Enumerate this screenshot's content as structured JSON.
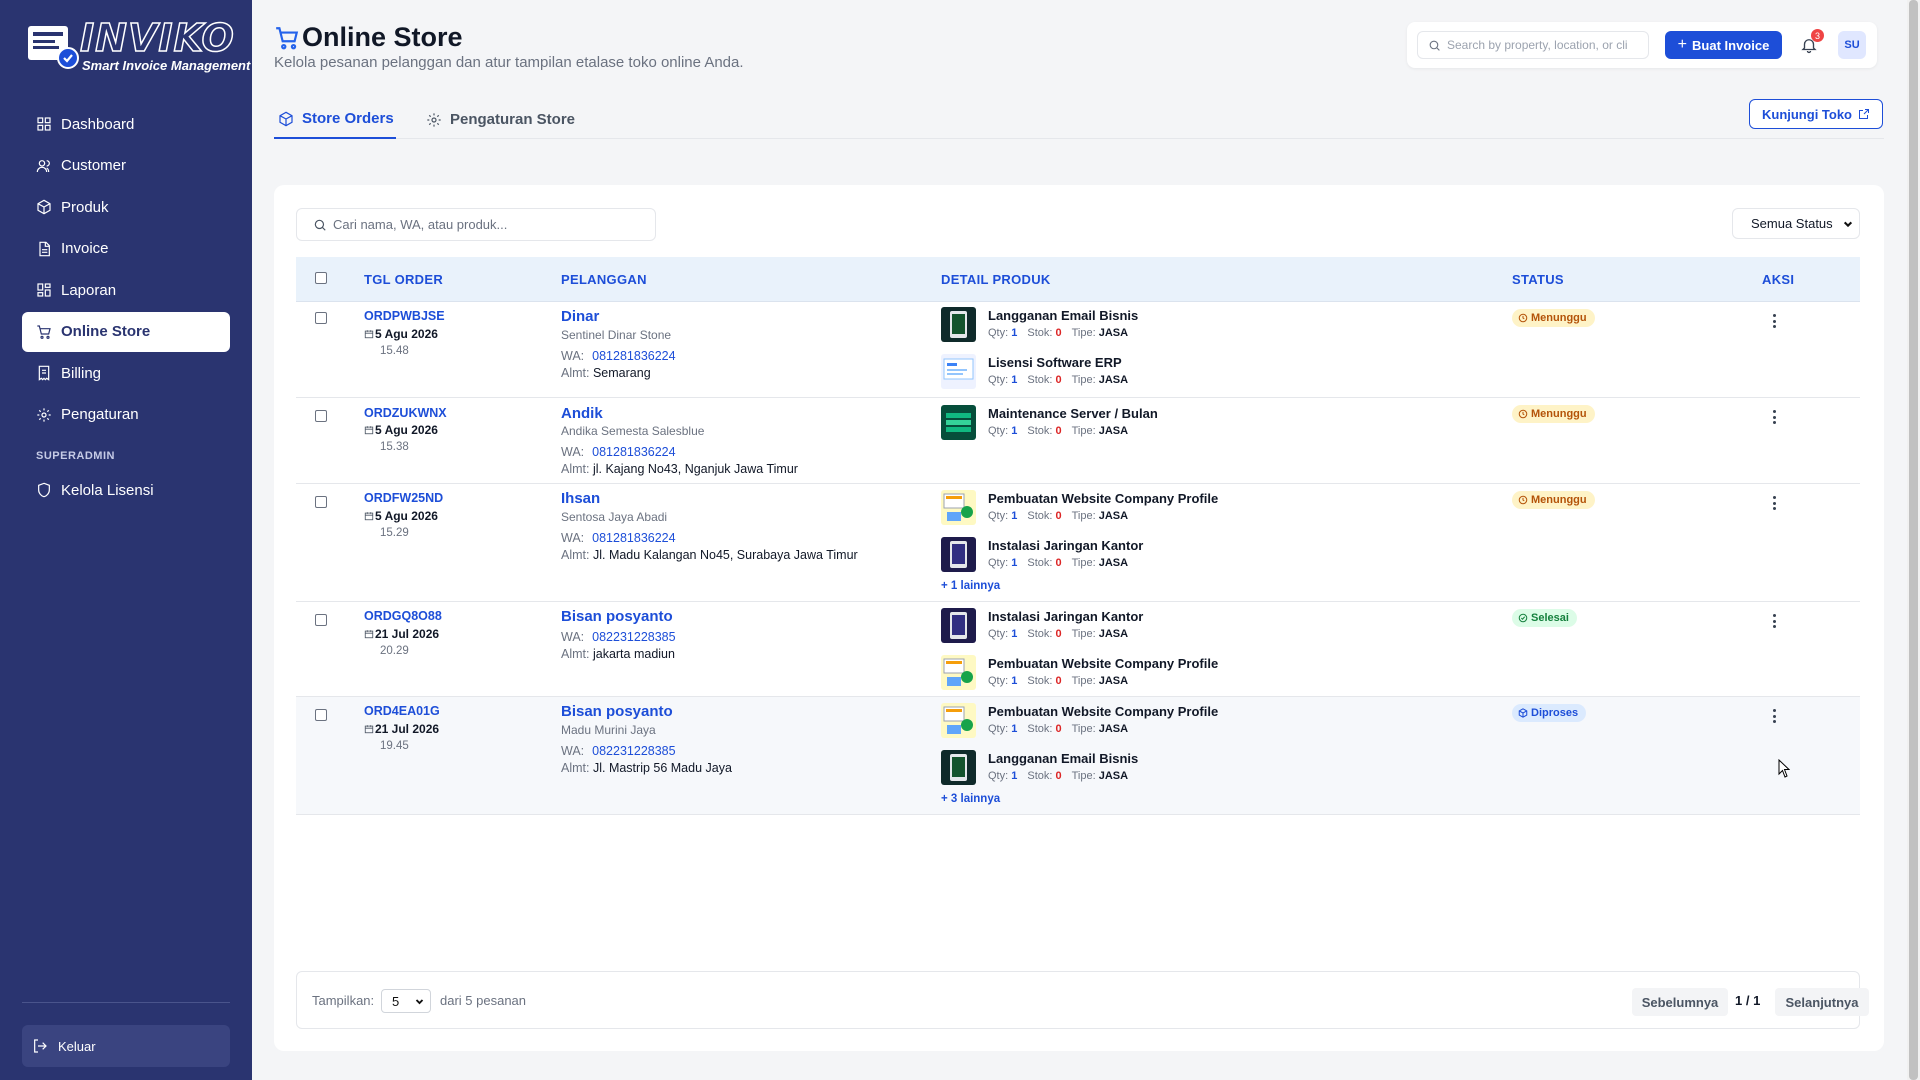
{
  "brand": {
    "name": "INVIKO",
    "tagline": "Smart Invoice Management"
  },
  "sidebar": {
    "items": [
      {
        "label": "Dashboard",
        "icon": "dashboard-icon"
      },
      {
        "label": "Customer",
        "icon": "users-icon"
      },
      {
        "label": "Produk",
        "icon": "box-icon"
      },
      {
        "label": "Invoice",
        "icon": "file-icon"
      },
      {
        "label": "Laporan",
        "icon": "grid-icon"
      },
      {
        "label": "Online Store",
        "icon": "cart-icon",
        "active": true
      },
      {
        "label": "Billing",
        "icon": "receipt-icon"
      },
      {
        "label": "Pengaturan",
        "icon": "gear-icon"
      }
    ],
    "section_label": "SUPERADMIN",
    "admin_item": {
      "label": "Kelola Lisensi",
      "icon": "shield-icon"
    },
    "logout_label": "Keluar"
  },
  "header": {
    "title": "Online Store",
    "subtitle": "Kelola pesanan pelanggan dan atur tampilan etalase toko online Anda.",
    "search_placeholder": "Search by property, location, or cli",
    "create_invoice_label": "Buat Invoice",
    "notification_count": "3",
    "avatar_initials": "SU"
  },
  "tabs": [
    {
      "label": "Store Orders",
      "active": true
    },
    {
      "label": "Pengaturan Store",
      "active": false
    }
  ],
  "visit_store_label": "Kunjungi Toko",
  "orders": {
    "search_placeholder": "Cari nama, WA, atau produk...",
    "status_filter": "Semua Status",
    "columns": [
      "TGL ORDER",
      "PELANGGAN",
      "DETAIL PRODUK",
      "STATUS",
      "AKSI"
    ],
    "labels": {
      "wa": "WA:",
      "addr": "Almt:",
      "qty": "Qty:",
      "stock": "Stok:",
      "type": "Tipe:"
    },
    "rows": [
      {
        "id": "ORDPWBJSE",
        "date": "5 Agu 2026",
        "time": "15.48",
        "name": "Dinar",
        "company": "Sentinel Dinar Stone",
        "wa": "081281836224",
        "address": "Semarang",
        "products": [
          {
            "name": "Langganan Email Bisnis",
            "qty": "1",
            "stock": "0",
            "type": "JASA"
          },
          {
            "name": "Lisensi Software ERP",
            "qty": "1",
            "stock": "0",
            "type": "JASA"
          }
        ],
        "more": "",
        "status": "Menunggu"
      },
      {
        "id": "ORDZUKWNX",
        "date": "5 Agu 2026",
        "time": "15.38",
        "name": "Andik",
        "company": "Andika Semesta Salesblue",
        "wa": "081281836224",
        "address": "jl. Kajang No43, Nganjuk Jawa Timur",
        "products": [
          {
            "name": "Maintenance Server / Bulan",
            "qty": "1",
            "stock": "0",
            "type": "JASA"
          }
        ],
        "more": "",
        "status": "Menunggu"
      },
      {
        "id": "ORDFW25ND",
        "date": "5 Agu 2026",
        "time": "15.29",
        "name": "Ihsan",
        "company": "Sentosa Jaya Abadi",
        "wa": "081281836224",
        "address": "Jl. Madu Kalangan No45, Surabaya Jawa Timur",
        "products": [
          {
            "name": "Pembuatan Website Company Profile",
            "qty": "1",
            "stock": "0",
            "type": "JASA"
          },
          {
            "name": "Instalasi Jaringan Kantor",
            "qty": "1",
            "stock": "0",
            "type": "JASA"
          }
        ],
        "more": "+ 1 lainnya",
        "status": "Menunggu"
      },
      {
        "id": "ORDGQ8O88",
        "date": "21 Jul 2026",
        "time": "20.29",
        "name": "Bisan posyanto",
        "company": "",
        "wa": "082231228385",
        "address": "jakarta madiun",
        "products": [
          {
            "name": "Instalasi Jaringan Kantor",
            "qty": "1",
            "stock": "0",
            "type": "JASA"
          },
          {
            "name": "Pembuatan Website Company Profile",
            "qty": "1",
            "stock": "0",
            "type": "JASA"
          }
        ],
        "more": "",
        "status": "Selesai"
      },
      {
        "id": "ORD4EA01G",
        "date": "21 Jul 2026",
        "time": "19.45",
        "name": "Bisan posyanto",
        "company": "Madu Murini Jaya",
        "wa": "082231228385",
        "address": "Jl. Mastrip 56 Madu Jaya",
        "products": [
          {
            "name": "Pembuatan Website Company Profile",
            "qty": "1",
            "stock": "0",
            "type": "JASA"
          },
          {
            "name": "Langganan Email Bisnis",
            "qty": "1",
            "stock": "0",
            "type": "JASA"
          }
        ],
        "more": "+ 3 lainnya",
        "status": "Diproses"
      }
    ]
  },
  "pagination": {
    "show_label": "Tampilkan:",
    "page_size": "5",
    "summary": "dari 5 pesanan",
    "prev_label": "Sebelumnya",
    "page_indicator": "1 / 1",
    "next_label": "Selanjutnya"
  },
  "colors": {
    "sidebar": "#2a3470",
    "accent": "#1d4ed8",
    "waiting": "#b45309",
    "done": "#15803d"
  }
}
